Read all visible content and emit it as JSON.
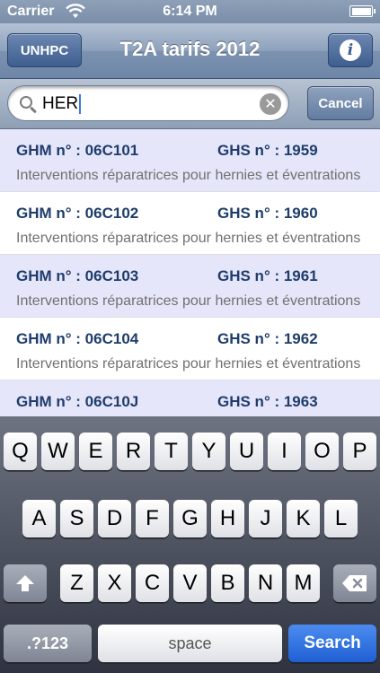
{
  "status": {
    "carrier": "Carrier",
    "time": "6:14 PM"
  },
  "nav": {
    "left_button": "UNHPC",
    "title": "T2A tarifs 2012",
    "info_glyph": "i"
  },
  "search": {
    "value": "HER",
    "cancel_label": "Cancel",
    "clear_glyph": "✕"
  },
  "results": [
    {
      "ghm": "GHM n° : 06C101",
      "ghs": "GHS n° : 1959",
      "desc": "Interventions réparatrices pour hernies et éventrations"
    },
    {
      "ghm": "GHM n° : 06C102",
      "ghs": "GHS n° : 1960",
      "desc": "Interventions réparatrices pour hernies et éventrations"
    },
    {
      "ghm": "GHM n° : 06C103",
      "ghs": "GHS n° : 1961",
      "desc": "Interventions réparatrices pour hernies et éventrations"
    },
    {
      "ghm": "GHM n° : 06C104",
      "ghs": "GHS n° : 1962",
      "desc": "Interventions réparatrices pour hernies et éventrations"
    },
    {
      "ghm": "GHM n° : 06C10J",
      "ghs": "GHS n° : 1963",
      "desc": ""
    }
  ],
  "keyboard": {
    "row1": [
      "Q",
      "W",
      "E",
      "R",
      "T",
      "Y",
      "U",
      "I",
      "O",
      "P"
    ],
    "row2": [
      "A",
      "S",
      "D",
      "F",
      "G",
      "H",
      "J",
      "K",
      "L"
    ],
    "row3": [
      "Z",
      "X",
      "C",
      "V",
      "B",
      "N",
      "M"
    ],
    "mode_label": ".?123",
    "space_label": "space",
    "search_label": "Search"
  },
  "colors": {
    "accent": "#1f3d6c",
    "alt_row": "#e6e6fa",
    "nav": "#6e86a8"
  }
}
